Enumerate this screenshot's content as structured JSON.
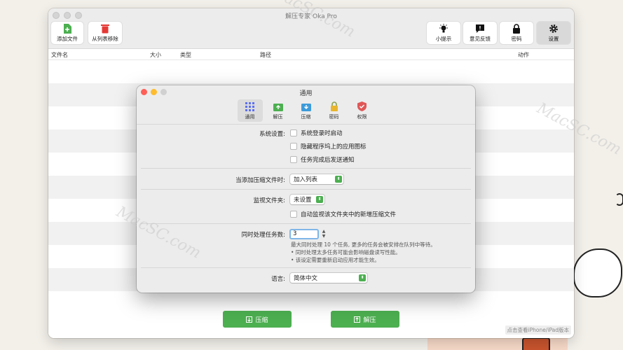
{
  "window": {
    "title": "解压专家 Oka Pro"
  },
  "toolbar": {
    "add_file": "添加文件",
    "remove_from_list": "从列表移除",
    "tips": "小提示",
    "feedback": "意见反馈",
    "password": "密码",
    "settings": "设置"
  },
  "columns": {
    "filename": "文件名",
    "size": "大小",
    "type": "类型",
    "path": "路径",
    "action": "动作"
  },
  "bottom": {
    "compress": "压缩",
    "decompress": "解压",
    "ipad_link": "点击查看iPhone/iPad版本"
  },
  "dialog": {
    "title": "通用",
    "tabs": [
      {
        "label": "通用",
        "icon": "grid-icon"
      },
      {
        "label": "解压",
        "icon": "decompress-icon"
      },
      {
        "label": "压缩",
        "icon": "compress-icon"
      },
      {
        "label": "密码",
        "icon": "lock-icon"
      },
      {
        "label": "权限",
        "icon": "shield-icon"
      }
    ],
    "system": {
      "label": "系统设置:",
      "login_start": "系统登录时启动",
      "hide_dock": "隐藏程序坞上的应用图标",
      "notify_done": "任务完成后发送通知"
    },
    "on_add": {
      "label": "当添加压缩文件时:",
      "value": "加入列表"
    },
    "watch_folder": {
      "label": "监视文件夹:",
      "value": "未设置",
      "auto_watch": "自动监视该文件夹中的新增压缩文件"
    },
    "concurrent": {
      "label": "同时处理任务数:",
      "value": "3",
      "note1": "最大同时处理 10 个任务, 更多的任务会被安排在队列中等待。",
      "note2": "• 同时处理太多任务可能会影响磁盘读写性能。",
      "note3": "• 该设定需要重新启动应用才能生效。"
    },
    "language": {
      "label": "语言:",
      "value": "简体中文"
    }
  },
  "watermarks": [
    "MacSC.com",
    "MacSC.com",
    "MacSC.com"
  ],
  "colors": {
    "accent_green": "#4caf50",
    "close_red": "#ff5f57",
    "minimize_yellow": "#febc2e",
    "zoom_gray": "#d0d0d0"
  }
}
